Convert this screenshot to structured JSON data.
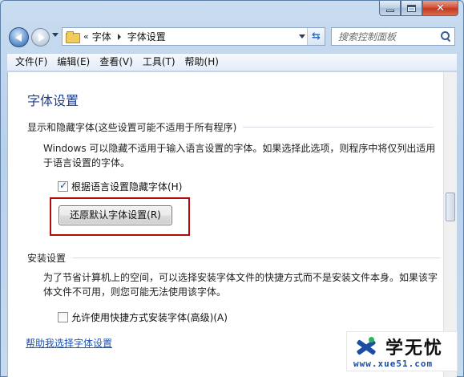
{
  "window": {
    "caption_buttons": [
      "minimize",
      "maximize",
      "close"
    ]
  },
  "address_bar": {
    "overflow": "«",
    "crumbs": [
      "字体",
      "字体设置"
    ]
  },
  "search": {
    "placeholder": "搜索控制面板"
  },
  "menu": [
    "文件(F)",
    "编辑(E)",
    "查看(V)",
    "工具(T)",
    "帮助(H)"
  ],
  "page": {
    "title": "字体设置",
    "hide_section": {
      "heading": "显示和隐藏字体(这些设置可能不适用于所有程序)",
      "description": "Windows 可以隐藏不适用于输入语言设置的字体。如果选择此选项，则程序中将仅列出适用于语言设置的字体。",
      "checkbox_label": "根据语言设置隐藏字体(H)",
      "checkbox_checked": true,
      "restore_button": "还原默认字体设置(R)"
    },
    "install_section": {
      "heading": "安装设置",
      "description": "为了节省计算机上的空间，可以选择安装字体文件的快捷方式而不是安装文件本身。如果该字体文件不可用，则您可能无法使用该字体。",
      "checkbox_label": "允许使用快捷方式安装字体(高级)(A)",
      "checkbox_checked": false
    },
    "help_link": "帮助我选择字体设置"
  },
  "watermark": {
    "name": "学无忧",
    "url": "www.xue51.com"
  },
  "colors": {
    "title_blue": "#1e3d8a",
    "link_blue": "#1f52b6",
    "highlight_red": "#b30b0b"
  }
}
